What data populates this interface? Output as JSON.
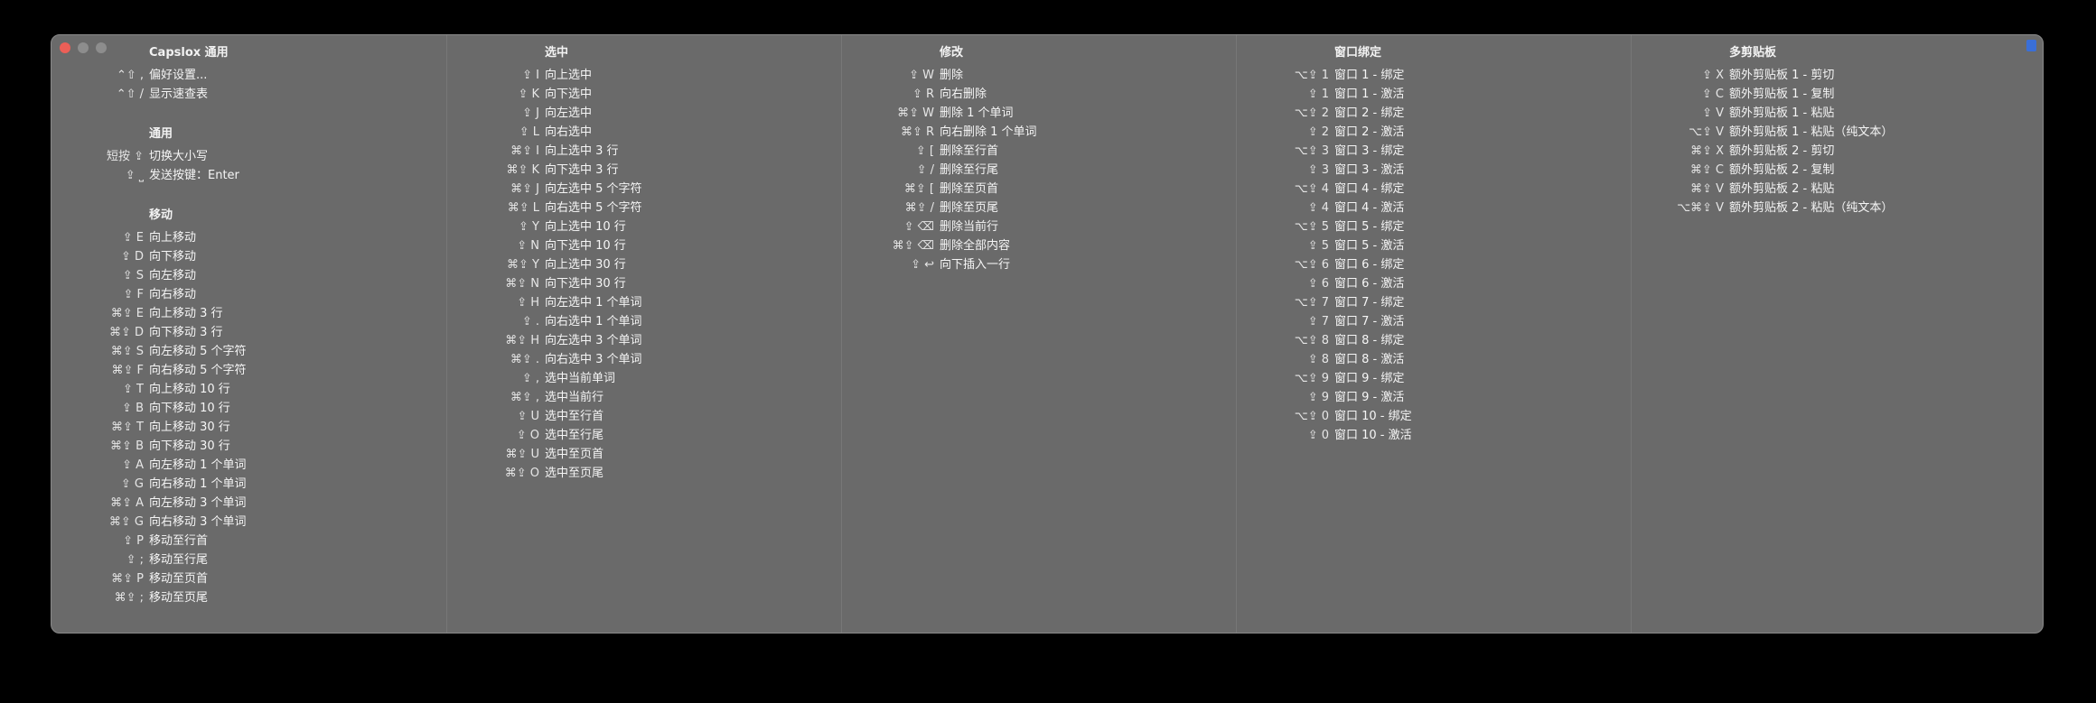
{
  "columns": [
    {
      "sections": [
        {
          "title": "Capslox 通用",
          "rows": [
            {
              "key": "⌃⇧ ,",
              "desc": "偏好设置..."
            },
            {
              "key": "⌃⇧ /",
              "desc": "显示速查表"
            }
          ]
        },
        {
          "title": "通用",
          "rows": [
            {
              "key": "短按 ⇪",
              "desc": "切换大小写"
            },
            {
              "key": "⇪ ⎵",
              "desc": "发送按键：Enter"
            }
          ]
        },
        {
          "title": "移动",
          "rows": [
            {
              "key": "⇪ E",
              "desc": "向上移动"
            },
            {
              "key": "⇪ D",
              "desc": "向下移动"
            },
            {
              "key": "⇪ S",
              "desc": "向左移动"
            },
            {
              "key": "⇪ F",
              "desc": "向右移动"
            },
            {
              "key": "⌘⇪ E",
              "desc": "向上移动 3 行"
            },
            {
              "key": "⌘⇪ D",
              "desc": "向下移动 3 行"
            },
            {
              "key": "⌘⇪ S",
              "desc": "向左移动 5 个字符"
            },
            {
              "key": "⌘⇪ F",
              "desc": "向右移动 5 个字符"
            },
            {
              "key": "⇪ T",
              "desc": "向上移动 10 行"
            },
            {
              "key": "⇪ B",
              "desc": "向下移动 10 行"
            },
            {
              "key": "⌘⇪ T",
              "desc": "向上移动 30 行"
            },
            {
              "key": "⌘⇪ B",
              "desc": "向下移动 30 行"
            },
            {
              "key": "⇪ A",
              "desc": "向左移动 1 个单词"
            },
            {
              "key": "⇪ G",
              "desc": "向右移动 1 个单词"
            },
            {
              "key": "⌘⇪ A",
              "desc": "向左移动 3 个单词"
            },
            {
              "key": "⌘⇪ G",
              "desc": "向右移动 3 个单词"
            },
            {
              "key": "⇪ P",
              "desc": "移动至行首"
            },
            {
              "key": "⇪ ;",
              "desc": "移动至行尾"
            },
            {
              "key": "⌘⇪ P",
              "desc": "移动至页首"
            },
            {
              "key": "⌘⇪ ;",
              "desc": "移动至页尾"
            }
          ]
        }
      ]
    },
    {
      "sections": [
        {
          "title": "选中",
          "rows": [
            {
              "key": "⇪ I",
              "desc": "向上选中"
            },
            {
              "key": "⇪ K",
              "desc": "向下选中"
            },
            {
              "key": "⇪ J",
              "desc": "向左选中"
            },
            {
              "key": "⇪ L",
              "desc": "向右选中"
            },
            {
              "key": "⌘⇪ I",
              "desc": "向上选中 3 行"
            },
            {
              "key": "⌘⇪ K",
              "desc": "向下选中 3 行"
            },
            {
              "key": "⌘⇪ J",
              "desc": "向左选中 5 个字符"
            },
            {
              "key": "⌘⇪ L",
              "desc": "向右选中 5 个字符"
            },
            {
              "key": "⇪ Y",
              "desc": "向上选中 10 行"
            },
            {
              "key": "⇪ N",
              "desc": "向下选中 10 行"
            },
            {
              "key": "⌘⇪ Y",
              "desc": "向上选中 30 行"
            },
            {
              "key": "⌘⇪ N",
              "desc": "向下选中 30 行"
            },
            {
              "key": "⇪ H",
              "desc": "向左选中 1 个单词"
            },
            {
              "key": "⇪ .",
              "desc": "向右选中 1 个单词"
            },
            {
              "key": "⌘⇪ H",
              "desc": "向左选中 3 个单词"
            },
            {
              "key": "⌘⇪ .",
              "desc": "向右选中 3 个单词"
            },
            {
              "key": "⇪ ,",
              "desc": "选中当前单词"
            },
            {
              "key": "⌘⇪ ,",
              "desc": "选中当前行"
            },
            {
              "key": "⇪ U",
              "desc": "选中至行首"
            },
            {
              "key": "⇪ O",
              "desc": "选中至行尾"
            },
            {
              "key": "⌘⇪ U",
              "desc": "选中至页首"
            },
            {
              "key": "⌘⇪ O",
              "desc": "选中至页尾"
            }
          ]
        }
      ]
    },
    {
      "sections": [
        {
          "title": "修改",
          "rows": [
            {
              "key": "⇪ W",
              "desc": "删除"
            },
            {
              "key": "⇪ R",
              "desc": "向右删除"
            },
            {
              "key": "⌘⇪ W",
              "desc": "删除 1 个单词"
            },
            {
              "key": "⌘⇪ R",
              "desc": "向右删除 1 个单词"
            },
            {
              "key": "⇪ [",
              "desc": "删除至行首"
            },
            {
              "key": "⇪ /",
              "desc": "删除至行尾"
            },
            {
              "key": "⌘⇪ [",
              "desc": "删除至页首"
            },
            {
              "key": "⌘⇪ /",
              "desc": "删除至页尾"
            },
            {
              "key": "⇪ ⌫",
              "desc": "删除当前行"
            },
            {
              "key": "⌘⇪ ⌫",
              "desc": "删除全部内容"
            },
            {
              "key": "⇪ ↩",
              "desc": "向下插入一行"
            }
          ]
        }
      ]
    },
    {
      "sections": [
        {
          "title": "窗口绑定",
          "rows": [
            {
              "key": "⌥⇪ 1",
              "desc": "窗口 1 - 绑定"
            },
            {
              "key": "⇪ 1",
              "desc": "窗口 1 - 激活"
            },
            {
              "key": "⌥⇪ 2",
              "desc": "窗口 2 - 绑定"
            },
            {
              "key": "⇪ 2",
              "desc": "窗口 2 - 激活"
            },
            {
              "key": "⌥⇪ 3",
              "desc": "窗口 3 - 绑定"
            },
            {
              "key": "⇪ 3",
              "desc": "窗口 3 - 激活"
            },
            {
              "key": "⌥⇪ 4",
              "desc": "窗口 4 - 绑定"
            },
            {
              "key": "⇪ 4",
              "desc": "窗口 4 - 激活"
            },
            {
              "key": "⌥⇪ 5",
              "desc": "窗口 5 - 绑定"
            },
            {
              "key": "⇪ 5",
              "desc": "窗口 5 - 激活"
            },
            {
              "key": "⌥⇪ 6",
              "desc": "窗口 6 - 绑定"
            },
            {
              "key": "⇪ 6",
              "desc": "窗口 6 - 激活"
            },
            {
              "key": "⌥⇪ 7",
              "desc": "窗口 7 - 绑定"
            },
            {
              "key": "⇪ 7",
              "desc": "窗口 7 - 激活"
            },
            {
              "key": "⌥⇪ 8",
              "desc": "窗口 8 - 绑定"
            },
            {
              "key": "⇪ 8",
              "desc": "窗口 8 - 激活"
            },
            {
              "key": "⌥⇪ 9",
              "desc": "窗口 9 - 绑定"
            },
            {
              "key": "⇪ 9",
              "desc": "窗口 9 - 激活"
            },
            {
              "key": "⌥⇪ 0",
              "desc": "窗口 10 - 绑定"
            },
            {
              "key": "⇪ 0",
              "desc": "窗口 10 - 激活"
            }
          ]
        }
      ]
    },
    {
      "sections": [
        {
          "title": "多剪贴板",
          "rows": [
            {
              "key": "⇪ X",
              "desc": "额外剪贴板 1 - 剪切"
            },
            {
              "key": "⇪ C",
              "desc": "额外剪贴板 1 - 复制"
            },
            {
              "key": "⇪ V",
              "desc": "额外剪贴板 1 - 粘贴"
            },
            {
              "key": "⌥⇪ V",
              "desc": "额外剪贴板 1 - 粘贴（纯文本）"
            },
            {
              "key": "⌘⇪ X",
              "desc": "额外剪贴板 2 - 剪切"
            },
            {
              "key": "⌘⇪ C",
              "desc": "额外剪贴板 2 - 复制"
            },
            {
              "key": "⌘⇪ V",
              "desc": "额外剪贴板 2 - 粘贴"
            },
            {
              "key": "⌥⌘⇪ V",
              "desc": "额外剪贴板 2 - 粘贴（纯文本）"
            }
          ]
        }
      ]
    }
  ]
}
